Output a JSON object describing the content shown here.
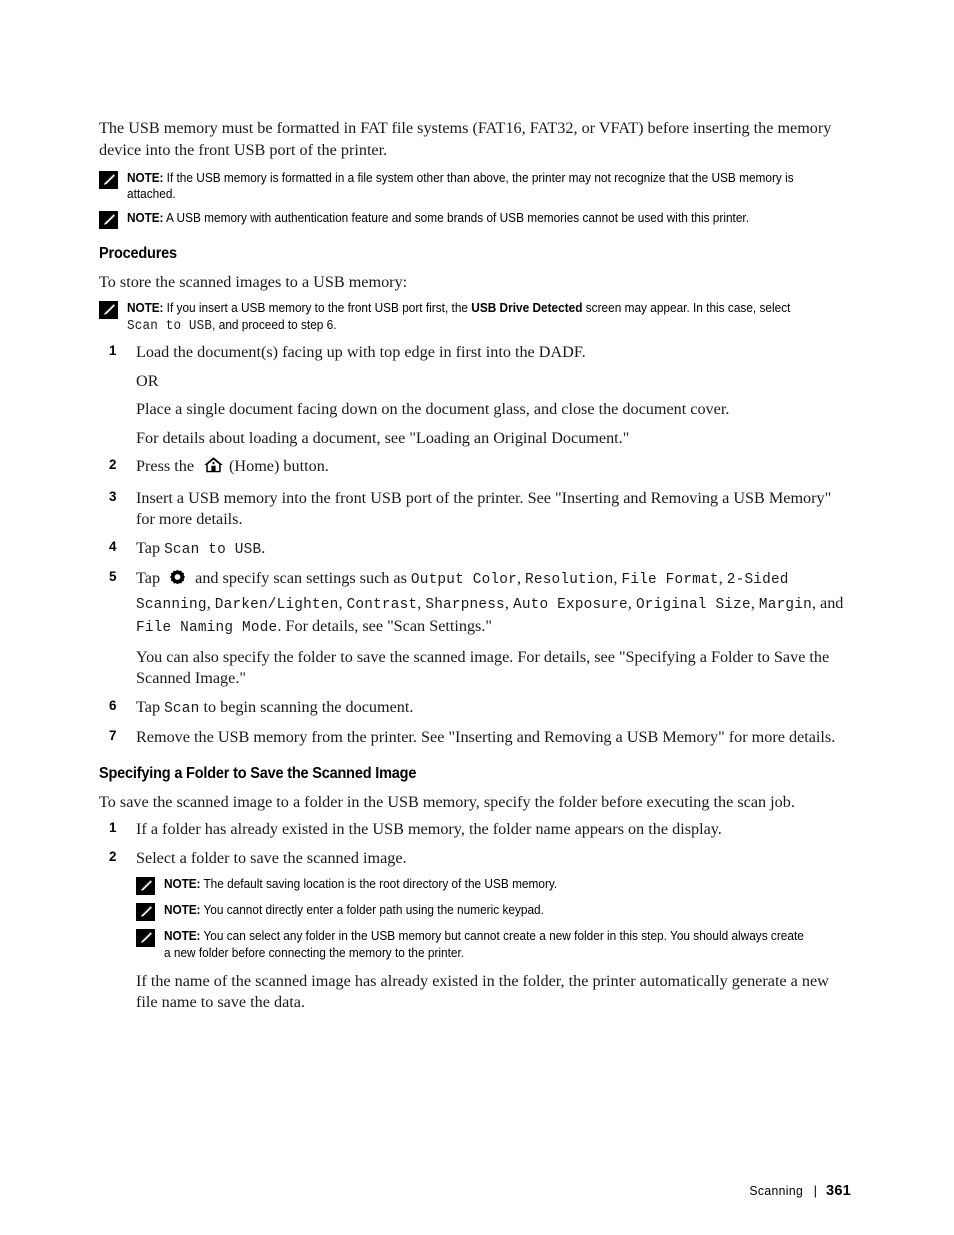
{
  "document": {
    "intro_paragraph": "The USB memory must be formatted in FAT file systems (FAT16, FAT32, or VFAT) before inserting the memory device into the front USB port of the printer.",
    "notes_top": [
      {
        "label": "NOTE:",
        "text": "If the USB memory is formatted in a file system other than above, the printer may not recognize that the USB memory is attached."
      },
      {
        "label": "NOTE:",
        "text": "A USB memory with authentication feature and some brands of USB memories cannot be used with this printer."
      }
    ],
    "section_procedures": {
      "heading": "Procedures",
      "lead_in": "To store the scanned images to a USB memory:",
      "note": {
        "label": "NOTE:",
        "part1": "If you insert a USB memory to the front USB port first, the ",
        "bold_screen": "USB Drive Detected",
        "part2": " screen may appear. In this case, select ",
        "mono_value": "Scan to USB",
        "part3": ", and proceed to step 6."
      },
      "steps": [
        {
          "num": "1",
          "text": "Load the document(s) facing up with top edge in first into the DADF.",
          "substeps": [
            "OR",
            "Place a single document facing down on the document glass, and close the document cover.",
            "For details about loading a document, see \"Loading an Original Document.\""
          ]
        },
        {
          "num": "2",
          "text_before_icon": "Press the ",
          "icon": "home-icon",
          "text_after_icon": "(Home) button."
        },
        {
          "num": "3",
          "text": "Insert a USB memory into the front USB port of the printer. See \"Inserting and Removing a USB Memory\" for more details."
        },
        {
          "num": "4",
          "text_before_mono": "Tap ",
          "mono_value": "Scan to USB",
          "text_after_mono": "."
        },
        {
          "num": "5",
          "text_before_icon": "Tap ",
          "icon": "gear-icon",
          "text_after_icon": " and specify scan settings such as ",
          "settings": [
            "Output Color",
            "Resolution",
            "File Format",
            "2-Sided Scanning",
            "Darken/Lighten",
            "Contrast",
            "Sharpness",
            "Auto Exposure",
            "Original Size",
            "Margin"
          ],
          "tail_connector": "and ",
          "tail_mono": "File Naming Mode",
          "tail_text": ". For details, see \"Scan Settings.\"",
          "substeps": [
            "You can also specify the folder to save the scanned image. For details, see \"Specifying a Folder to Save the Scanned Image.\""
          ]
        },
        {
          "num": "6",
          "text_before_mono": "Tap ",
          "mono_value": "Scan",
          "text_after_mono": " to begin scanning the document."
        },
        {
          "num": "7",
          "text": "Remove the USB memory from the printer. See \"Inserting and Removing a USB Memory\" for more details."
        }
      ]
    },
    "section_folder": {
      "heading": "Specifying a Folder to Save the Scanned Image",
      "lead_in": "To save the scanned image to a folder in the USB memory, specify the folder before executing the scan job.",
      "steps": [
        {
          "num": "1",
          "text": "If a folder has already existed in the USB memory, the folder name appears on the display."
        },
        {
          "num": "2",
          "text": "Select a folder to save the scanned image."
        }
      ],
      "notes": [
        {
          "label": "NOTE:",
          "text": "The default saving location is the root directory of the USB memory."
        },
        {
          "label": "NOTE:",
          "text": "You cannot directly enter a folder path using the numeric keypad."
        },
        {
          "label": "NOTE:",
          "text": "You can select any folder in the USB memory but cannot create a new folder in this step. You should always create a new folder before connecting the memory to the printer."
        }
      ],
      "closing_paragraph": "If the name of the scanned image has already existed in the folder, the printer automatically generate a new file name to save the data."
    },
    "footer": {
      "section": "Scanning",
      "separator": "|",
      "page_number": "361"
    },
    "colors": {
      "text": "#1a1a1a",
      "heading": "#000000",
      "background": "#ffffff",
      "note_icon": "#000000"
    }
  }
}
